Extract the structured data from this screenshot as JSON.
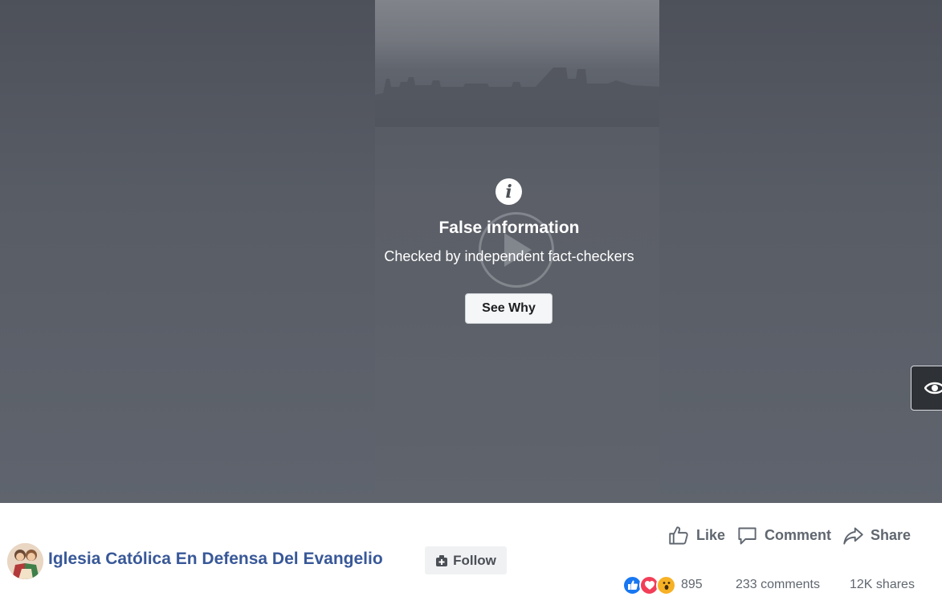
{
  "video": {
    "warning_title": "False information",
    "warning_subtitle": "Checked by independent fact-checkers",
    "see_why_label": "See Why"
  },
  "post": {
    "page_name": "Iglesia Católica En Defensa Del Evangelio",
    "follow_label": "Follow",
    "actions": {
      "like_label": "Like",
      "comment_label": "Comment",
      "share_label": "Share"
    },
    "stats": {
      "reaction_count": "895",
      "comments": "233 comments",
      "shares": "12K shares"
    }
  },
  "colors": {
    "page_name": "#385898",
    "like_reaction": "#1877f2",
    "love_reaction": "#f33e58",
    "wow_reaction": "#f7b125"
  }
}
